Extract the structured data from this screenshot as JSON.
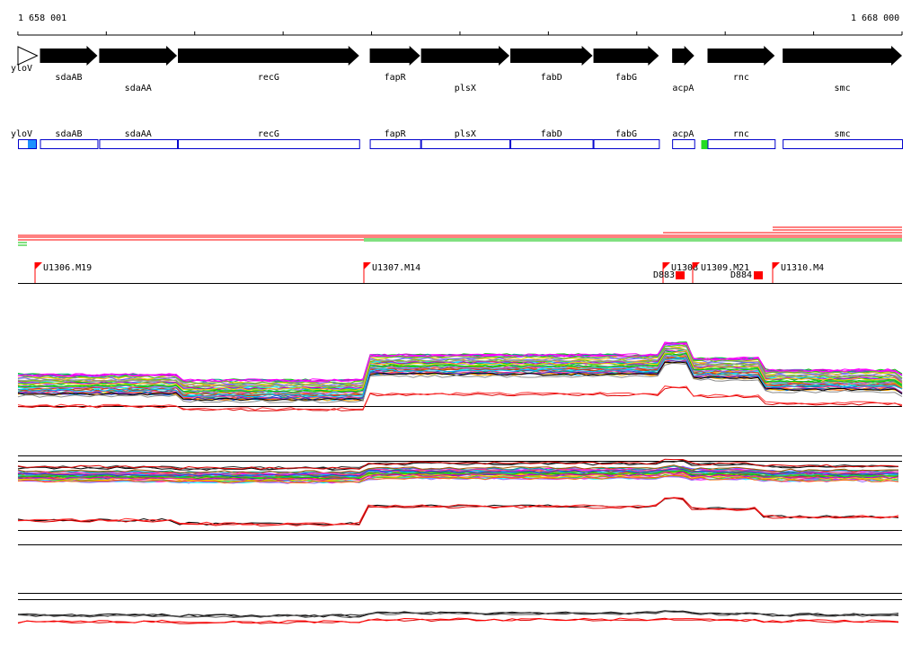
{
  "ruler": {
    "start_label": "1 658 001",
    "end_label": "1 668 000",
    "start": 1658001,
    "end": 1668000
  },
  "genes": [
    {
      "name": "yloV",
      "strand": "+",
      "start": 1658001,
      "end": 1658220
    },
    {
      "name": "sdaAB",
      "strand": "+",
      "start": 1658250,
      "end": 1658900
    },
    {
      "name": "sdaAA",
      "strand": "+",
      "start": 1658920,
      "end": 1659800
    },
    {
      "name": "recG",
      "strand": "+",
      "start": 1659810,
      "end": 1661860
    },
    {
      "name": "fapR",
      "strand": "+",
      "start": 1661980,
      "end": 1662550
    },
    {
      "name": "plsX",
      "strand": "+",
      "start": 1662560,
      "end": 1663560
    },
    {
      "name": "fabD",
      "strand": "+",
      "start": 1663570,
      "end": 1664500
    },
    {
      "name": "fabG",
      "strand": "+",
      "start": 1664510,
      "end": 1665250
    },
    {
      "name": "acpA",
      "strand": "+",
      "start": 1665400,
      "end": 1665650
    },
    {
      "name": "rnc",
      "strand": "+",
      "start": 1665800,
      "end": 1666560
    },
    {
      "name": "smc",
      "strand": "+",
      "start": 1666650,
      "end": 1668000
    }
  ],
  "gene_label_rows": {
    "top": [
      "sdaAB",
      "fapR",
      "fabD",
      "fabG",
      "rnc"
    ],
    "bottom": [
      "sdaAA",
      "plsX",
      "acpA",
      "smc"
    ],
    "left": [
      "yloV"
    ]
  },
  "colors": {
    "gene_arrow": "#000000",
    "gene_box": "#0000cc",
    "marker_blue": "#1e90ff",
    "marker_green": "#22dd22",
    "promoter_flag": "#ff0000",
    "terminator": "#ff0000",
    "trace_red": "#dd0000",
    "trace_black": "#000000"
  },
  "tu_markers": [
    {
      "label": "U1306.M19",
      "position": 1658200
    },
    {
      "label": "U1307.M14",
      "position": 1661920
    },
    {
      "label": "U1308",
      "position": 1665200
    },
    {
      "label": "U1309.M21",
      "position": 1665520
    },
    {
      "label": "U1310.M4",
      "position": 1666420
    }
  ],
  "terminators": [
    {
      "label": "D883",
      "position": 1665380
    },
    {
      "label": "D884",
      "position": 1666260
    }
  ],
  "tu_label_overlap_fragment": "U1308U1309.M21"
}
